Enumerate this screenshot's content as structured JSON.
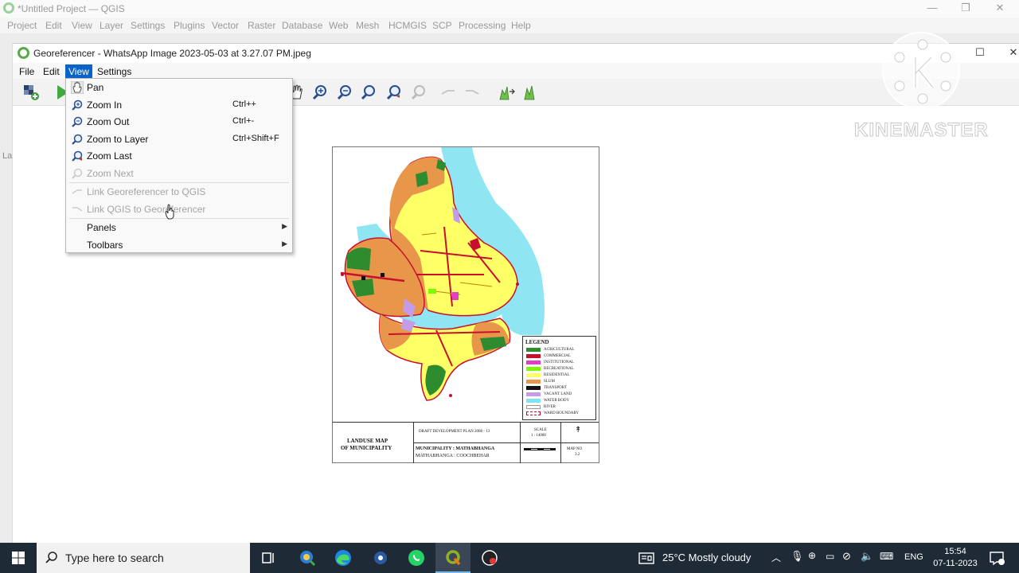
{
  "qgis": {
    "title": "*Untitled Project — QGIS",
    "menu": [
      "Project",
      "Edit",
      "View",
      "Layer",
      "Settings",
      "Plugins",
      "Vector",
      "Raster",
      "Database",
      "Web",
      "Mesh",
      "HCMGIS",
      "SCP",
      "Processing",
      "Help"
    ],
    "side_label": "La"
  },
  "georef": {
    "title": "Georeferencer - WhatsApp Image 2023-05-03 at 3.27.07 PM.jpeg",
    "menu": {
      "file": "File",
      "edit": "Edit",
      "view": "View",
      "settings": "Settings"
    }
  },
  "view_menu": {
    "items": [
      {
        "label": "Pan",
        "shortcut": "",
        "icon": "pan-hand-icon",
        "enabled": true
      },
      {
        "label": "Zoom In",
        "shortcut": "Ctrl++",
        "icon": "zoom-in-icon",
        "enabled": true
      },
      {
        "label": "Zoom Out",
        "shortcut": "Ctrl+-",
        "icon": "zoom-out-icon",
        "enabled": true
      },
      {
        "label": "Zoom to Layer",
        "shortcut": "Ctrl+Shift+F",
        "icon": "zoom-to-layer-icon",
        "enabled": true
      },
      {
        "label": "Zoom Last",
        "shortcut": "",
        "icon": "zoom-last-icon",
        "enabled": true
      },
      {
        "label": "Zoom Next",
        "shortcut": "",
        "icon": "zoom-next-icon",
        "enabled": false
      },
      {
        "label": "Link Georeferencer to QGIS",
        "shortcut": "",
        "icon": "link-icon",
        "enabled": false
      },
      {
        "label": "Link QGIS to Georeferencer",
        "shortcut": "",
        "icon": "link-icon",
        "enabled": false
      },
      {
        "label": "Panels",
        "shortcut": "",
        "icon": "",
        "enabled": true,
        "submenu": true
      },
      {
        "label": "Toolbars",
        "shortcut": "",
        "icon": "",
        "enabled": true,
        "submenu": true
      }
    ]
  },
  "map": {
    "legend_title": "LEGEND",
    "legend": [
      {
        "label": "AGRICULTURAL",
        "color": "#2e8b2e"
      },
      {
        "label": "COMMERCIAL",
        "color": "#c8102e"
      },
      {
        "label": "INSTITUTIONAL",
        "color": "#e040c8"
      },
      {
        "label": "RECREATIONAL",
        "color": "#7cfc00"
      },
      {
        "label": "RESIDENTIAL",
        "color": "#ffff66"
      },
      {
        "label": "SLUM",
        "color": "#e8964a"
      },
      {
        "label": "TRANSPORT",
        "color": "#111111"
      },
      {
        "label": "VACANT LAND",
        "color": "#c39be6"
      },
      {
        "label": "WATER BODY",
        "color": "#7fe4f0"
      },
      {
        "label": "RIVER",
        "color": "#ffffff"
      },
      {
        "label": "WARD BOUNDARY",
        "color": "#c8102e"
      }
    ],
    "footer": {
      "title_line1": "LANDUSE MAP",
      "title_line2": "OF MUNICIPALITY",
      "plan": "DRAFT DEVELOPMENT PLAN 2008 - 13",
      "scale_label": "SCALE",
      "scale_value": "1 : 14000",
      "municipality": "MUNICIPALITY : MATHABHANGA",
      "district": "MATHABHANGA : COOCHBEHAR",
      "map_no_label": "MAP NO",
      "map_no": "3.2"
    }
  },
  "watermark": {
    "text": "KINEMASTER"
  },
  "taskbar": {
    "search_placeholder": "Type here to search",
    "weather": "25°C  Mostly cloudy",
    "language": "ENG",
    "time": "15:54",
    "date": "07-11-2023"
  }
}
